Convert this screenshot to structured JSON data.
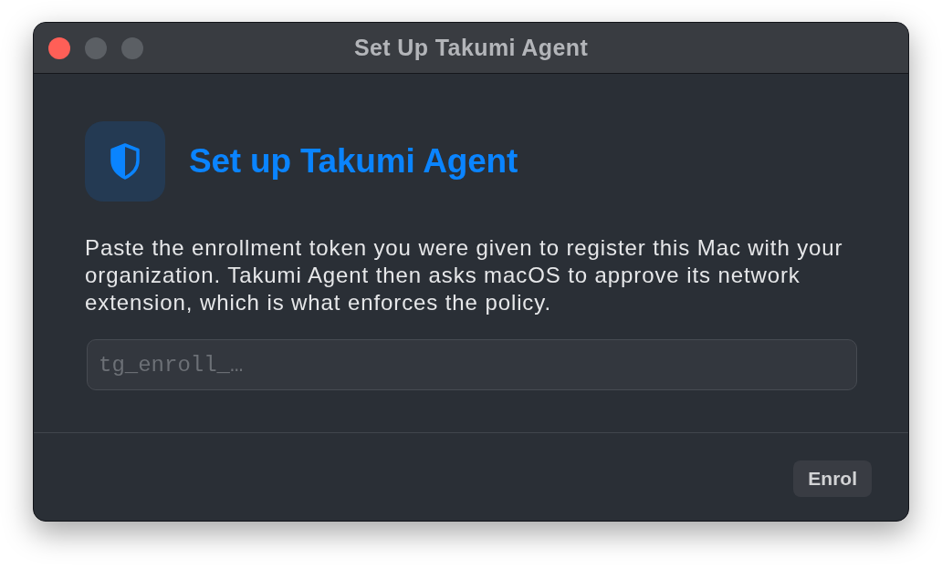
{
  "window": {
    "title": "Set Up Takumi Agent",
    "controls": [
      {
        "kind": "close",
        "disabled": false
      },
      {
        "kind": "minimize",
        "disabled": true
      },
      {
        "kind": "zoom",
        "disabled": true
      }
    ]
  },
  "header": {
    "title": "Set up Takumi Agent"
  },
  "description": "Paste the enrollment token you were given to register this Mac with your organization. Takumi Agent then asks macOS to approve its network extension, which is what enforces the policy.",
  "token_field": {
    "placeholder": "tg_enroll_…"
  },
  "footer": {
    "buttons": [
      "Enrol"
    ]
  }
}
